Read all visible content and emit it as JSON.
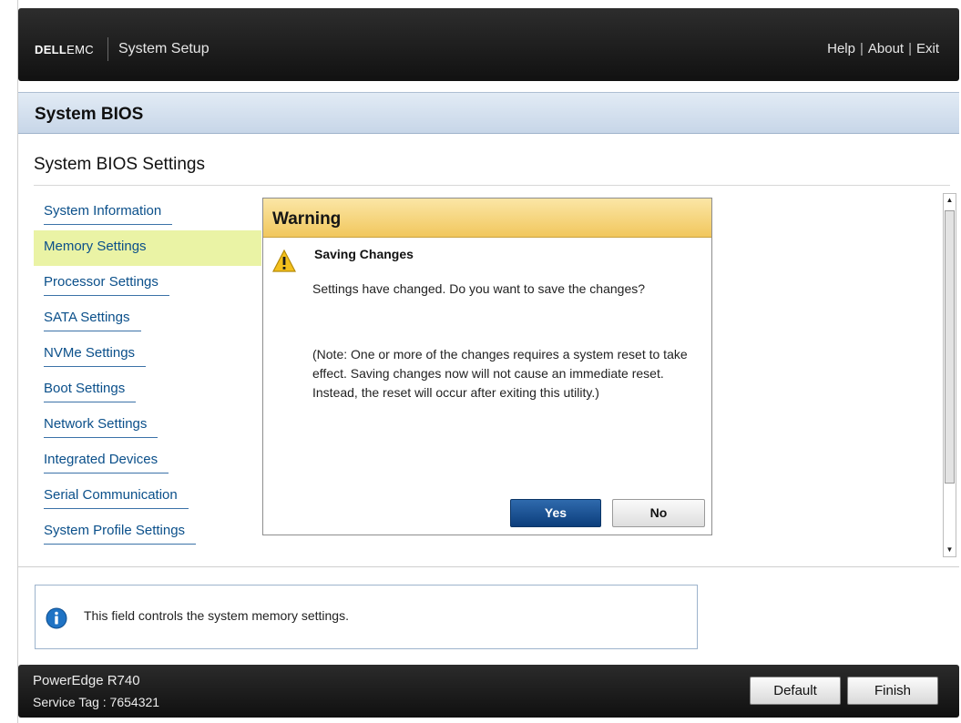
{
  "header": {
    "brand_dell": "DELL",
    "brand_emc": "EMC",
    "app_title": "System Setup",
    "links": [
      "Help",
      "About",
      "Exit"
    ],
    "link_separator": "|"
  },
  "section": {
    "title": "System BIOS"
  },
  "page": {
    "title": "System BIOS Settings"
  },
  "menu": {
    "active_index": 1,
    "items": [
      {
        "label": "System Information"
      },
      {
        "label": "Memory Settings"
      },
      {
        "label": "Processor Settings"
      },
      {
        "label": "SATA Settings"
      },
      {
        "label": "NVMe Settings"
      },
      {
        "label": "Boot Settings"
      },
      {
        "label": "Network Settings"
      },
      {
        "label": "Integrated Devices"
      },
      {
        "label": "Serial Communication"
      },
      {
        "label": "System Profile Settings"
      }
    ]
  },
  "dialog": {
    "title": "Warning",
    "icon": "warning-triangle-icon",
    "heading": "Saving Changes",
    "message": "Settings have changed. Do you want to save the changes?",
    "note": "(Note: One or more of the changes requires a system reset to take effect. Saving changes now will not cause an immediate reset. Instead, the reset will occur after exiting this utility.)",
    "yes_label": "Yes",
    "no_label": "No"
  },
  "help": {
    "icon": "info-icon",
    "text": "This field controls the system memory settings."
  },
  "footer": {
    "model": "PowerEdge R740",
    "service_tag": "Service Tag : 7654321",
    "default_label": "Default",
    "finish_label": "Finish"
  },
  "colors": {
    "header_bg": "#1c1c1c",
    "section_bar": "#d3e0ee",
    "active_menu_bg": "#eaf3a5",
    "link_color": "#0a4f8a",
    "warning_header": "#f4cf6b",
    "yes_button": "#1a4f90"
  }
}
